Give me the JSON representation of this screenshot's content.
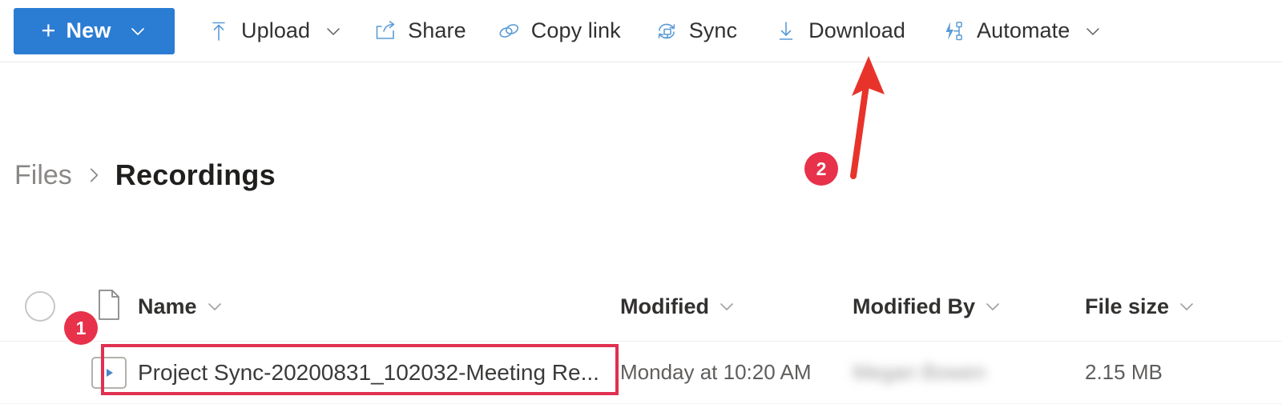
{
  "colors": {
    "accent_blue": "#2b7cd3",
    "icon_blue": "#5b9bd5",
    "annotation_red": "#e8314a",
    "highlight_red": "#e03050",
    "text_primary": "#323130",
    "text_secondary": "#605e5c"
  },
  "commandbar": {
    "new_button": {
      "label": "New",
      "plus_icon": "plus-icon",
      "caret_icon": "chevron-down-icon"
    },
    "commands": [
      {
        "id": "upload",
        "label": "Upload",
        "icon": "upload-icon",
        "has_caret": true
      },
      {
        "id": "share",
        "label": "Share",
        "icon": "share-icon",
        "has_caret": false
      },
      {
        "id": "copylink",
        "label": "Copy link",
        "icon": "link-icon",
        "has_caret": false
      },
      {
        "id": "sync",
        "label": "Sync",
        "icon": "sync-icon",
        "has_caret": false
      },
      {
        "id": "download",
        "label": "Download",
        "icon": "download-icon",
        "has_caret": false
      },
      {
        "id": "automate",
        "label": "Automate",
        "icon": "automate-icon",
        "has_caret": true
      }
    ]
  },
  "breadcrumb": {
    "root": "Files",
    "separator_icon": "chevron-right-icon",
    "current": "Recordings"
  },
  "table": {
    "select_all_icon": "circle-checkbox-icon",
    "type_column_icon": "document-icon",
    "headers": {
      "name": "Name",
      "modified": "Modified",
      "modified_by": "Modified By",
      "file_size": "File size"
    },
    "sort_caret_icon": "chevron-down-icon",
    "rows": [
      {
        "file_icon": "video-play-icon",
        "name": "Project Sync-20200831_102032-Meeting Re...",
        "modified": "Monday at 10:20 AM",
        "modified_by": "Megan Bowen",
        "file_size": "2.15 MB"
      }
    ]
  },
  "annotations": {
    "step_one": "1",
    "step_two": "2",
    "arrow_icon": "arrow-up-icon",
    "highlight_icon": "rectangle-highlight"
  }
}
